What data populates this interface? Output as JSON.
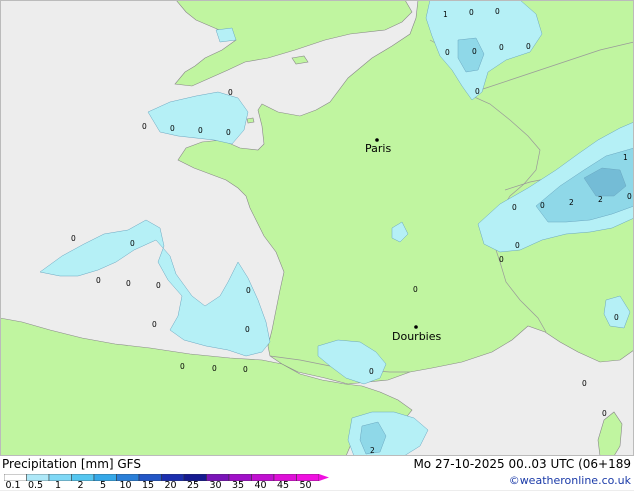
{
  "map": {
    "cities": [
      {
        "name": "Paris"
      },
      {
        "name": "Dourbies"
      }
    ],
    "point_values": [
      "1",
      "0",
      "0",
      "0",
      "0",
      "0",
      "0",
      "0",
      "0",
      "0",
      "0",
      "0",
      "0",
      "0",
      "0",
      "0",
      "0",
      "0",
      "0",
      "0",
      "0",
      "0",
      "0",
      "0",
      "1",
      "2",
      "2",
      "0",
      "0",
      "0",
      "0",
      "0",
      "0",
      "0",
      "0",
      "0",
      "0",
      "2"
    ]
  },
  "legend": {
    "title": "Precipitation [mm] GFS",
    "ticks": [
      "0.1",
      "0.5",
      "1",
      "2",
      "5",
      "10",
      "15",
      "20",
      "25",
      "30",
      "35",
      "40",
      "45",
      "50"
    ],
    "colors": [
      "#ffffff",
      "#aee8f8",
      "#7fd8f6",
      "#55c6f0",
      "#35a8e8",
      "#2a7fd8",
      "#2356c6",
      "#1c2fae",
      "#151a90",
      "#7a14b8",
      "#a010c8",
      "#c010d0",
      "#de10d8",
      "#f010e0"
    ]
  },
  "valid_time": "Mo 27-10-2025 00..03 UTC (06+189",
  "credit": "©weatheronline.co.uk",
  "colors": {
    "sea": "#ededed",
    "land": "#c0f5a0",
    "precip_light": "#b5f0f6",
    "precip_medium": "#8fd8e8",
    "precip_strong": "#74bcd6"
  }
}
